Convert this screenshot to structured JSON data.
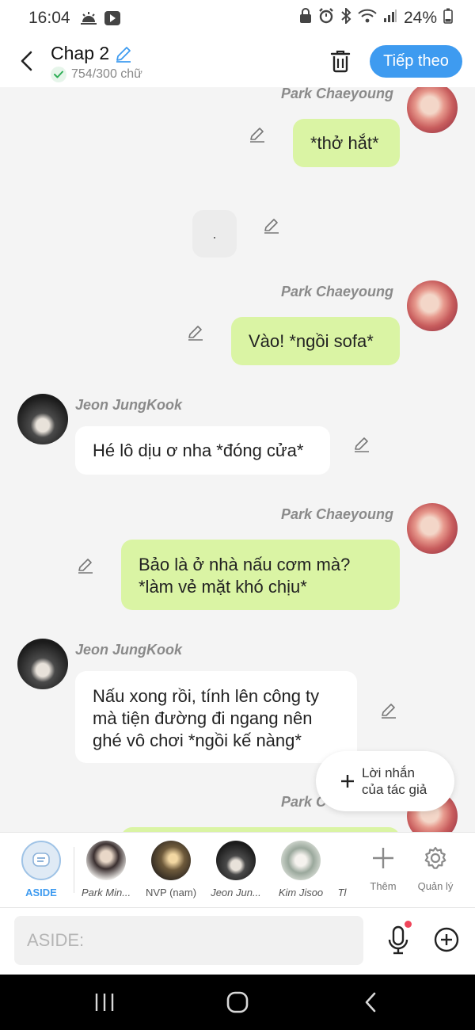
{
  "status_bar": {
    "time": "16:04",
    "battery": "24%"
  },
  "header": {
    "title": "Chap 2",
    "word_count": "754/300 chữ",
    "next_label": "Tiếp theo"
  },
  "messages": [
    {
      "speaker": "Park Chaeyoung",
      "text": "*thở hắt*",
      "side": "right"
    },
    {
      "speaker": "",
      "text": ".",
      "side": "center"
    },
    {
      "speaker": "Park Chaeyoung",
      "text": "Vào! *ngồi sofa*",
      "side": "right"
    },
    {
      "speaker": "Jeon JungKook",
      "text": "Hé lô dịu ơ nha *đóng cửa*",
      "side": "left"
    },
    {
      "speaker": "Park Chaeyoung",
      "text": "Bảo là ở nhà nấu cơm mà?\n*làm vẻ mặt khó chịu*",
      "side": "right"
    },
    {
      "speaker": "Jeon JungKook",
      "text": "Nấu xong rồi, tính lên công ty\nmà tiện đường đi ngang nên\nghé vô chơi *ngồi kế nàng*",
      "side": "left"
    },
    {
      "speaker": "Park C",
      "text": "",
      "side": "right"
    }
  ],
  "author_note": {
    "label": "Lời nhắn\ncủa tác giả"
  },
  "characters": [
    {
      "name": "ASIDE"
    },
    {
      "name": "Park Min..."
    },
    {
      "name": "NVP (nam)"
    },
    {
      "name": "Jeon Jun..."
    },
    {
      "name": "Kim Jisoo"
    },
    {
      "name": "Tl"
    }
  ],
  "tools": {
    "add_label": "Thêm",
    "manage_label": "Quản lý"
  },
  "input": {
    "placeholder": "ASIDE:"
  },
  "colors": {
    "accent": "#3e9bf0",
    "bubble_green": "#daf4a4",
    "bubble_white": "#ffffff",
    "background": "#f4f4f4"
  }
}
